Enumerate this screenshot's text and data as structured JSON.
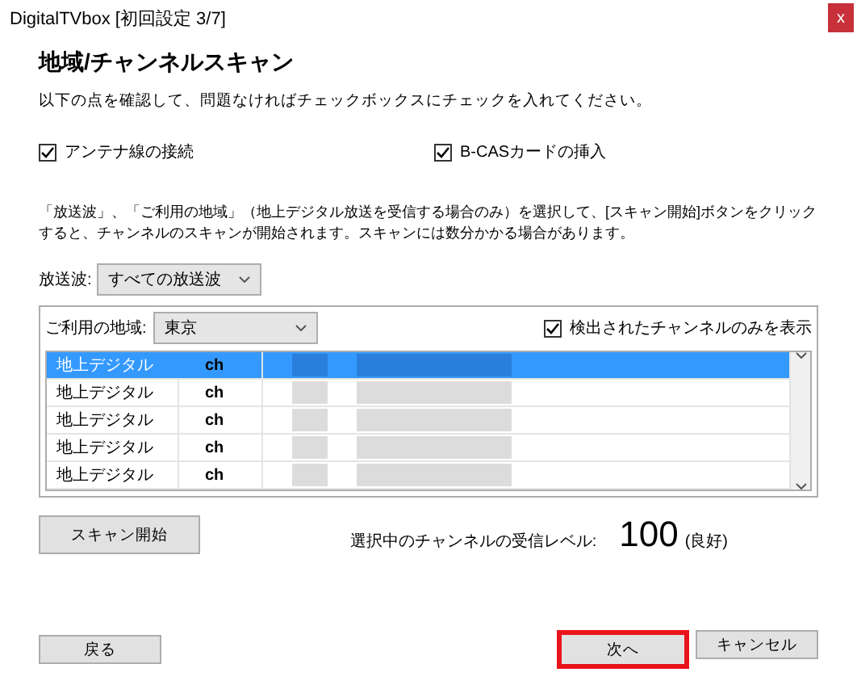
{
  "window": {
    "title": "DigitalTVbox [初回設定 3/7]",
    "close": "x"
  },
  "heading": "地域/チャンネルスキャン",
  "instruction": "以下の点を確認して、問題なければチェックボックスにチェックを入れてください。",
  "checks": [
    {
      "label": "アンテナ線の接続",
      "checked": true
    },
    {
      "label": "B-CASカードの挿入",
      "checked": true
    }
  ],
  "description": "「放送波」、「ご利用の地域」（地上デジタル放送を受信する場合のみ）を選択して、[スキャン開始]ボタンをクリックすると、チャンネルのスキャンが開始されます。スキャンには数分かかる場合があります。",
  "broadcast": {
    "label": "放送波:",
    "value": "すべての放送波"
  },
  "region": {
    "label": "ご利用の地域:",
    "value": "東京"
  },
  "detected_only": {
    "label": "検出されたチャンネルのみを表示",
    "checked": true
  },
  "rows": [
    {
      "type": "地上デジタル",
      "channel": "ch",
      "selected": true
    },
    {
      "type": "地上デジタル",
      "channel": "ch",
      "selected": false
    },
    {
      "type": "地上デジタル",
      "channel": "ch",
      "selected": false
    },
    {
      "type": "地上デジタル",
      "channel": "ch",
      "selected": false
    },
    {
      "type": "地上デジタル",
      "channel": "ch",
      "selected": false
    }
  ],
  "scan_button": "スキャン開始",
  "signal": {
    "label": "選択中のチャンネルの受信レベル:",
    "value": "100",
    "quality": "(良好)"
  },
  "back_button": {
    "label": "戻る",
    "highlighted": false
  },
  "buttons": [
    {
      "label": "次へ",
      "highlighted": true
    },
    {
      "label": "キャンセル",
      "highlighted": false
    }
  ]
}
